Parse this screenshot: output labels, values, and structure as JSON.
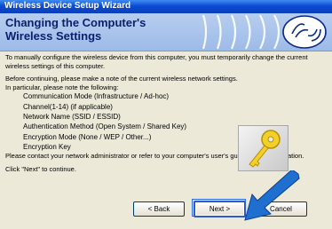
{
  "window": {
    "title": "Wireless Device Setup Wizard"
  },
  "banner": {
    "title": "Changing the Computer's Wireless Settings"
  },
  "content": {
    "paragraph1": "To manually configure the wireless device from this computer, you must temporarily change the current wireless settings of this computer.",
    "paragraph2_line1": "Before continuing, please make a note of the current wireless network settings.",
    "paragraph2_line2": "In particular, please note the following:",
    "items": [
      "Communication Mode (Infrastructure / Ad-hoc)",
      "Channel(1-14) (if applicable)",
      "Network Name (SSID / ESSID)",
      "Authentication Method (Open System / Shared Key)",
      "Encryption Mode (None / WEP / Other...)",
      "Encryption Key"
    ],
    "contact": "Please contact your network administrator or refer to your computer's user's guide for the information.",
    "instruction": "Click \"Next\" to continue."
  },
  "buttons": {
    "back": "< Back",
    "next": "Next >",
    "cancel": "Cancel"
  },
  "colors": {
    "title_bar": "#0a4bd3",
    "banner": "#b7cdee",
    "banner_text": "#0a1f6e",
    "arrow": "#1f6fd0",
    "dialog_bg": "#ece9d8"
  }
}
